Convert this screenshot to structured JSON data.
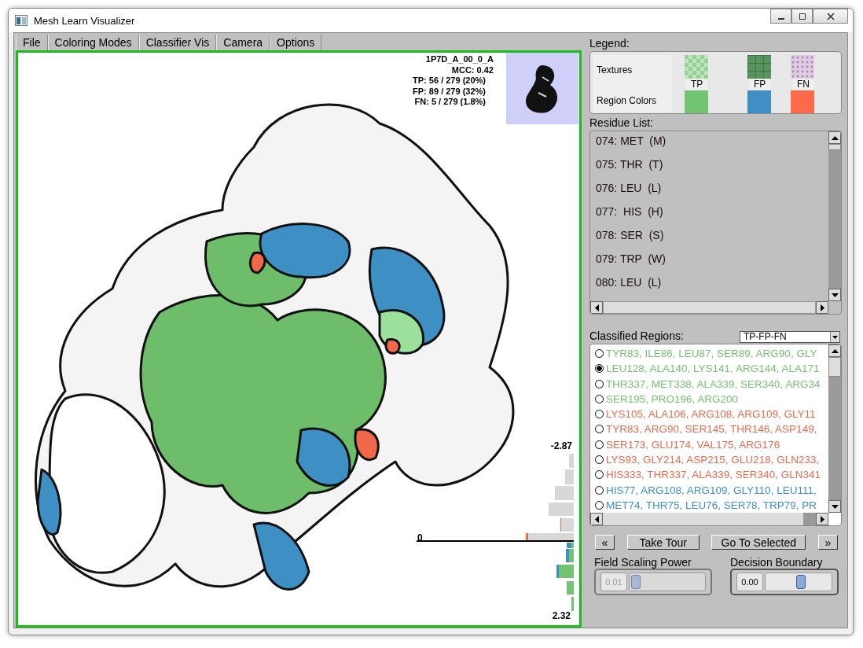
{
  "window": {
    "title": "Mesh Learn Visualizer"
  },
  "menu": [
    {
      "label": "File"
    },
    {
      "label": "Coloring Modes"
    },
    {
      "label": "Classifier Vis"
    },
    {
      "label": "Camera"
    },
    {
      "label": "Options"
    }
  ],
  "viewport": {
    "info": [
      "1P7D_A_00_0_A",
      "MCC: 0.42",
      "TP: 56 / 279 (20%)",
      "FP: 89 / 279 (32%)",
      "FN: 5 / 279 (1.8%)"
    ],
    "histogram": {
      "top_label": "-2.87",
      "zero_label": "0",
      "bottom_label": "2.32"
    }
  },
  "legend": {
    "title": "Legend:",
    "textures_label": "Textures",
    "colors_label": "Region Colors",
    "items": [
      {
        "label": "TP",
        "kind": "checker",
        "color": "#72c472"
      },
      {
        "label": "FP",
        "kind": "grid",
        "color": "#3f8fc6"
      },
      {
        "label": "FN",
        "kind": "speckle",
        "color": "#ff6a4a"
      }
    ]
  },
  "residue_list": {
    "title": "Residue List:",
    "items": [
      "074: MET  (M)",
      "075: THR  (T)",
      "076: LEU  (L)",
      "077:  HIS  (H)",
      "078: SER  (S)",
      "079: TRP  (W)",
      "080: LEU  (L)"
    ]
  },
  "classified_regions": {
    "title": "Classified Regions:",
    "filter": "TP-FP-FN",
    "items": [
      {
        "text": "TYR83, ILE86, LEU87, SER89, ARG90, GLY",
        "color": "#72c472",
        "selected": false
      },
      {
        "text": "LEU128, ALA140, LYS141, ARG144, ALA171",
        "color": "#72c472",
        "selected": true
      },
      {
        "text": "THR337, MET338, ALA339, SER340, ARG34",
        "color": "#72c472",
        "selected": false
      },
      {
        "text": "SER195, PRO196, ARG200",
        "color": "#72c472",
        "selected": false
      },
      {
        "text": "LYS105, ALA106, ARG108, ARG109, GLY11",
        "color": "#f0684a",
        "selected": false
      },
      {
        "text": "TYR83, ARG90, SER145, THR146, ASP149,",
        "color": "#f0684a",
        "selected": false
      },
      {
        "text": "SER173, GLU174, VAL175, ARG176",
        "color": "#f0684a",
        "selected": false
      },
      {
        "text": "LYS93, GLY214, ASP215, GLU218, GLN233,",
        "color": "#f0684a",
        "selected": false
      },
      {
        "text": "HIS333, THR337, ALA339, SER340, GLN341",
        "color": "#f0684a",
        "selected": false
      },
      {
        "text": "HIS77, ARG108, ARG109, GLY110, LEU111,",
        "color": "#3d8fd0",
        "selected": false
      },
      {
        "text": "MET74, THR75, LEU76, SER78, TRP79, PR",
        "color": "#3d8fd0",
        "selected": false
      }
    ]
  },
  "buttons": [
    {
      "label": "«"
    },
    {
      "label": "Take Tour"
    },
    {
      "label": "Go To Selected"
    },
    {
      "label": "»"
    }
  ],
  "sliders": [
    {
      "label": "Field Scaling Power",
      "value": "0.01",
      "level": 0.03,
      "disabled": true
    },
    {
      "label": "Decision Boundary",
      "value": "0.00",
      "level": 0.55,
      "disabled": false
    }
  ]
}
